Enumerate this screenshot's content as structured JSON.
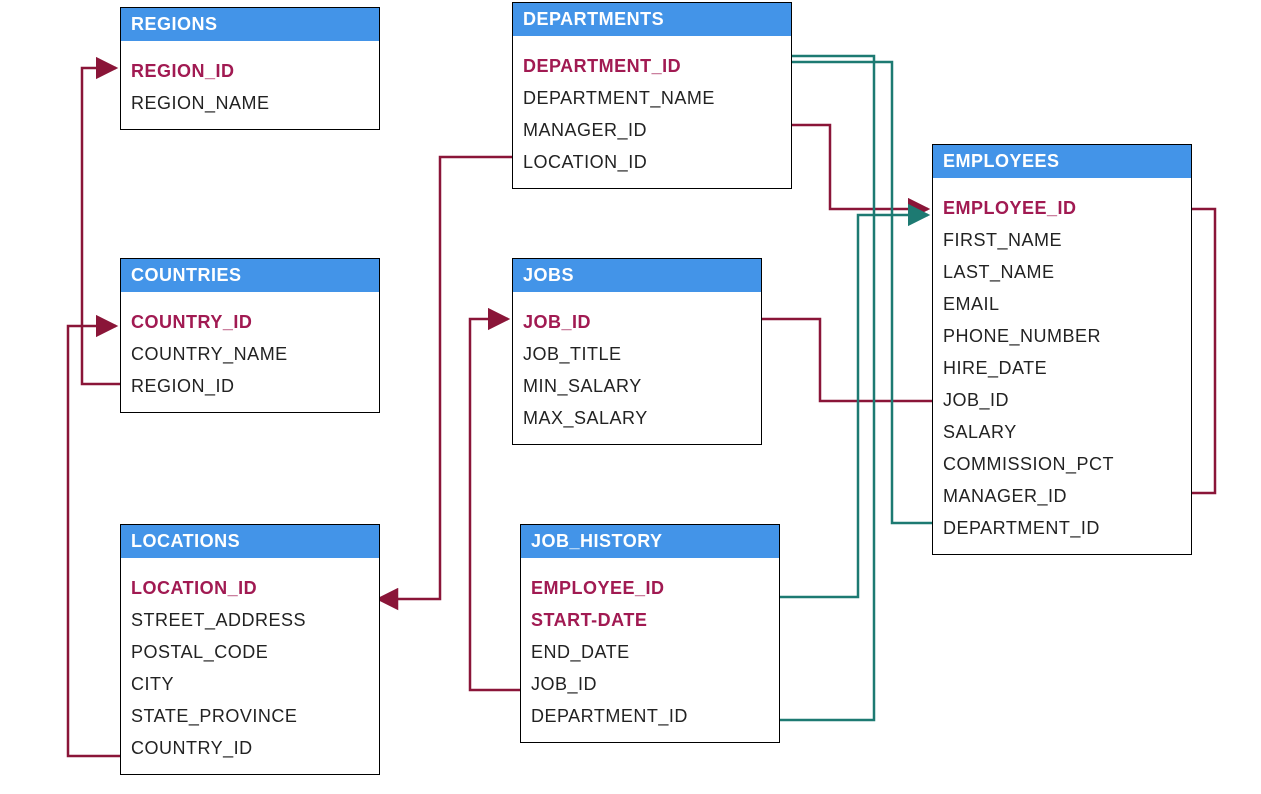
{
  "colors": {
    "headerBg": "#4394e8",
    "headerText": "#ffffff",
    "pkText": "#a11a52",
    "border": "#000000",
    "redLine": "#8a1538",
    "tealLine": "#1d7a72"
  },
  "entities": {
    "regions": {
      "title": "REGIONS",
      "fields": [
        {
          "name": "REGION_ID",
          "pk": true
        },
        {
          "name": "REGION_NAME",
          "pk": false
        }
      ]
    },
    "countries": {
      "title": "COUNTRIES",
      "fields": [
        {
          "name": "COUNTRY_ID",
          "pk": true
        },
        {
          "name": "COUNTRY_NAME",
          "pk": false
        },
        {
          "name": "REGION_ID",
          "pk": false
        }
      ]
    },
    "locations": {
      "title": "LOCATIONS",
      "fields": [
        {
          "name": "LOCATION_ID",
          "pk": true
        },
        {
          "name": "STREET_ADDRESS",
          "pk": false
        },
        {
          "name": "POSTAL_CODE",
          "pk": false
        },
        {
          "name": "CITY",
          "pk": false
        },
        {
          "name": "STATE_PROVINCE",
          "pk": false
        },
        {
          "name": "COUNTRY_ID",
          "pk": false
        }
      ]
    },
    "departments": {
      "title": "DEPARTMENTS",
      "fields": [
        {
          "name": "DEPARTMENT_ID",
          "pk": true
        },
        {
          "name": "DEPARTMENT_NAME",
          "pk": false
        },
        {
          "name": "MANAGER_ID",
          "pk": false
        },
        {
          "name": "LOCATION_ID",
          "pk": false
        }
      ]
    },
    "jobs": {
      "title": "JOBS",
      "fields": [
        {
          "name": "JOB_ID",
          "pk": true
        },
        {
          "name": "JOB_TITLE",
          "pk": false
        },
        {
          "name": "MIN_SALARY",
          "pk": false
        },
        {
          "name": "MAX_SALARY",
          "pk": false
        }
      ]
    },
    "job_history": {
      "title": "JOB_HISTORY",
      "fields": [
        {
          "name": "EMPLOYEE_ID",
          "pk": true
        },
        {
          "name": "START-DATE",
          "pk": true
        },
        {
          "name": "END_DATE",
          "pk": false
        },
        {
          "name": "JOB_ID",
          "pk": false
        },
        {
          "name": "DEPARTMENT_ID",
          "pk": false
        }
      ]
    },
    "employees": {
      "title": "EMPLOYEES",
      "fields": [
        {
          "name": "EMPLOYEE_ID",
          "pk": true
        },
        {
          "name": "FIRST_NAME",
          "pk": false
        },
        {
          "name": "LAST_NAME",
          "pk": false
        },
        {
          "name": "EMAIL",
          "pk": false
        },
        {
          "name": "PHONE_NUMBER",
          "pk": false
        },
        {
          "name": "HIRE_DATE",
          "pk": false
        },
        {
          "name": "JOB_ID",
          "pk": false
        },
        {
          "name": "SALARY",
          "pk": false
        },
        {
          "name": "COMMISSION_PCT",
          "pk": false
        },
        {
          "name": "MANAGER_ID",
          "pk": false
        },
        {
          "name": "DEPARTMENT_ID",
          "pk": false
        }
      ]
    }
  },
  "relationships": [
    {
      "from": "COUNTRIES.REGION_ID",
      "to": "REGIONS.REGION_ID"
    },
    {
      "from": "LOCATIONS.COUNTRY_ID",
      "to": "COUNTRIES.COUNTRY_ID"
    },
    {
      "from": "DEPARTMENTS.LOCATION_ID",
      "to": "LOCATIONS.LOCATION_ID"
    },
    {
      "from": "DEPARTMENTS.MANAGER_ID",
      "to": "EMPLOYEES.EMPLOYEE_ID"
    },
    {
      "from": "EMPLOYEES.JOB_ID",
      "to": "JOBS.JOB_ID"
    },
    {
      "from": "EMPLOYEES.MANAGER_ID",
      "to": "EMPLOYEES.EMPLOYEE_ID"
    },
    {
      "from": "EMPLOYEES.DEPARTMENT_ID",
      "to": "DEPARTMENTS.DEPARTMENT_ID"
    },
    {
      "from": "JOB_HISTORY.JOB_ID",
      "to": "JOBS.JOB_ID"
    },
    {
      "from": "JOB_HISTORY.EMPLOYEE_ID",
      "to": "EMPLOYEES.EMPLOYEE_ID"
    },
    {
      "from": "JOB_HISTORY.DEPARTMENT_ID",
      "to": "DEPARTMENTS.DEPARTMENT_ID"
    }
  ]
}
